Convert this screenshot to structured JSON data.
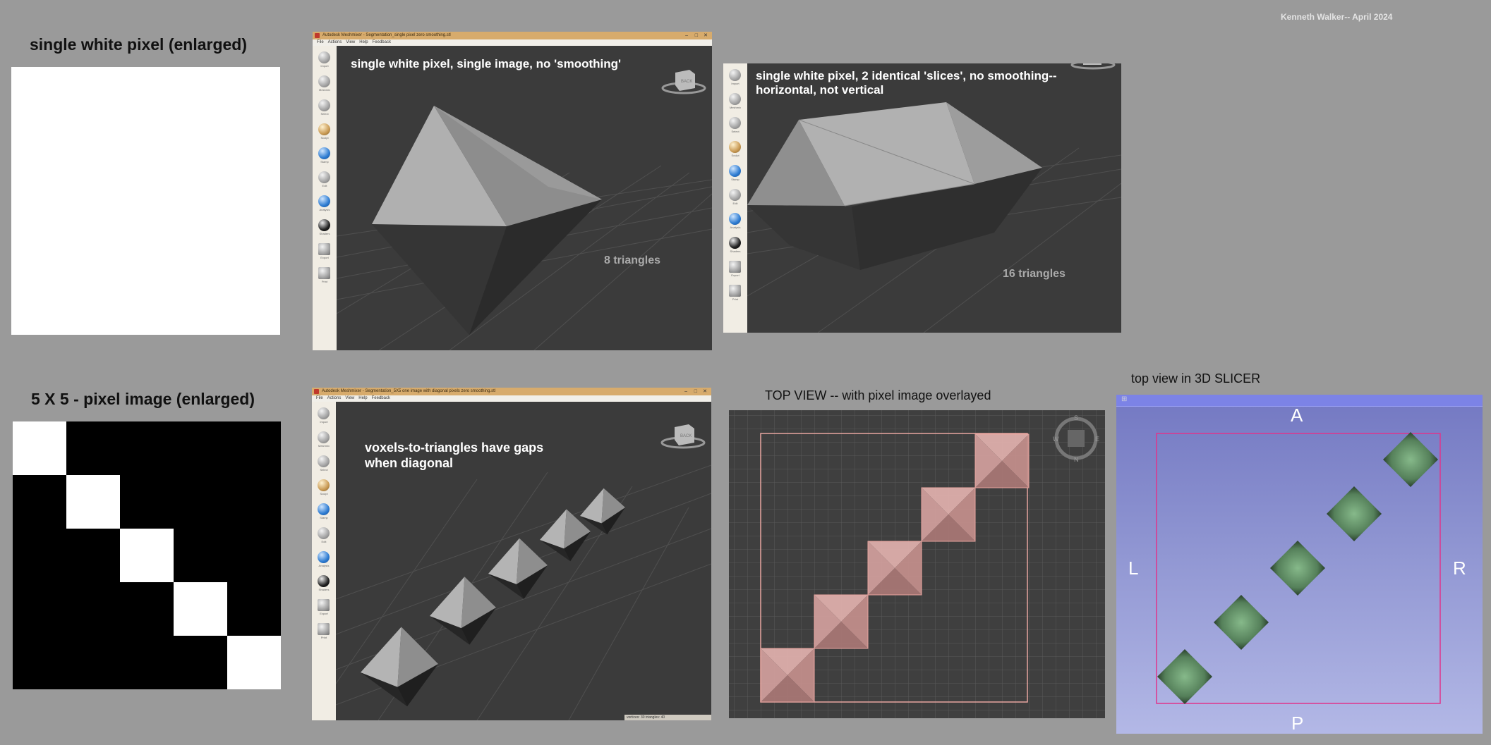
{
  "credit": "Kenneth Walker-- April 2024",
  "panel_single_pixel": {
    "label": "single white pixel (enlarged)"
  },
  "panel_5x5": {
    "label": "5 X 5 - pixel image (enlarged)",
    "grid": [
      [
        1,
        0,
        0,
        0,
        0
      ],
      [
        0,
        1,
        0,
        0,
        0
      ],
      [
        0,
        0,
        1,
        0,
        0
      ],
      [
        0,
        0,
        0,
        1,
        0
      ],
      [
        0,
        0,
        0,
        0,
        1
      ]
    ]
  },
  "window1": {
    "title": "Autodesk Meshmixer - Segmentation_single pixel zero smoothing.stl",
    "menu": [
      "File",
      "Actions",
      "View",
      "Help",
      "Feedback"
    ],
    "viewport_text": "single white pixel, single image, no 'smoothing'",
    "triangle_count": "8 triangles",
    "cube_label": "BACK"
  },
  "window2": {
    "viewport_text_line1": "single white pixel, 2 identical 'slices', no smoothing--",
    "viewport_text_line2": "horizontal, not vertical",
    "triangle_count": "16 triangles"
  },
  "window3": {
    "title": "Autodesk Meshmixer - Segmentation_5X5 one image with diagonal pixels zero smoothing.stl",
    "menu": [
      "File",
      "Actions",
      "View",
      "Help",
      "Feedback"
    ],
    "viewport_text_line1": "voxels-to-triangles have gaps",
    "viewport_text_line2": "when diagonal",
    "status": "vertices: 30  triangles: 40",
    "cube_label": "BACK"
  },
  "tools": [
    {
      "label": "Import",
      "icon": "plus-icon"
    },
    {
      "label": "Meshmix",
      "icon": "meshmix-icon"
    },
    {
      "label": "Select",
      "icon": "select-arrow-icon"
    },
    {
      "label": "Sculpt",
      "icon": "sculpt-brush-icon"
    },
    {
      "label": "Stamp",
      "icon": "stamp-icon"
    },
    {
      "label": "Edit",
      "icon": "edit-icon"
    },
    {
      "label": "Analysis",
      "icon": "analysis-icon"
    },
    {
      "label": "Shaders",
      "icon": "shaders-icon"
    },
    {
      "label": "Export",
      "icon": "export-icon"
    },
    {
      "label": "Print",
      "icon": "print-icon"
    }
  ],
  "topview": {
    "label": "TOP VIEW  -- with pixel image overlayed",
    "compass": {
      "top": "S",
      "left": "W",
      "right": "E",
      "bottom": "N"
    }
  },
  "slicer": {
    "label": "top view in 3D SLICER",
    "axes": {
      "top": "A",
      "left": "L",
      "right": "R",
      "bottom": "P"
    }
  },
  "colors": {
    "background": "#9a9a9a",
    "viewport": "#3b3b3b",
    "title_bar": "#d7ab6c",
    "slicer_blue": "#8c92d0",
    "overlay_pink": "#e88a8a",
    "diamond_green": "#5f8f63"
  }
}
